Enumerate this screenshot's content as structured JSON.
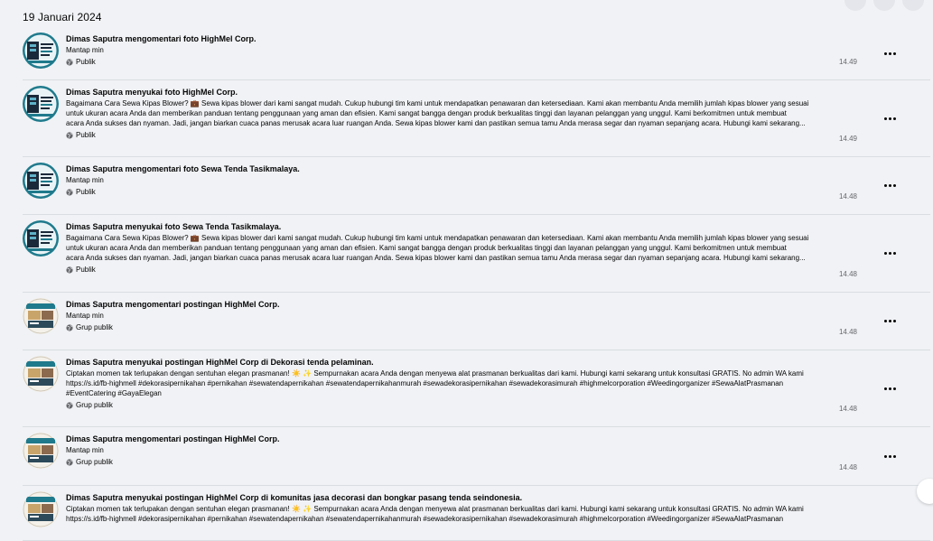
{
  "date_header": "19 Januari 2024",
  "colors": {
    "background": "#f0f2f5",
    "divider": "#dadde1",
    "time_gray": "#65676b",
    "logo_teal": "#1f7a8c"
  },
  "items": [
    {
      "avatar": "highmel-logo",
      "title": "Dimas Saputra mengomentari foto HighMel Corp.",
      "body": [
        "Mantap min"
      ],
      "privacy": "Publik",
      "privacy_icon": "globe-icon",
      "time": "14.49"
    },
    {
      "avatar": "highmel-logo",
      "title": "Dimas Saputra menyukai foto HighMel Corp.",
      "body": [
        "Bagaimana Cara Sewa Kipas Blower? 💼 Sewa kipas blower dari kami sangat mudah. Cukup hubungi tim kami untuk mendapatkan penawaran dan ketersediaan. Kami akan membantu Anda memilih jumlah kipas blower yang sesuai",
        "untuk ukuran acara Anda dan memberikan panduan tentang penggunaan yang aman dan efisien. Kami sangat bangga dengan produk berkualitas tinggi dan layanan pelanggan yang unggul. Kami berkomitmen untuk membuat",
        "acara Anda sukses dan nyaman. Jadi, jangan biarkan cuaca panas merusak acara luar ruangan Anda. Sewa kipas blower kami dan pastikan semua tamu Anda merasa segar dan nyaman sepanjang acara. Hubungi kami sekarang..."
      ],
      "privacy": "Publik",
      "privacy_icon": "globe-icon",
      "time": "14.49"
    },
    {
      "avatar": "highmel-logo",
      "title": "Dimas Saputra mengomentari foto Sewa Tenda Tasikmalaya.",
      "body": [
        "Mantap min"
      ],
      "privacy": "Publik",
      "privacy_icon": "globe-icon",
      "time": "14.48"
    },
    {
      "avatar": "highmel-logo",
      "title": "Dimas Saputra menyukai foto Sewa Tenda Tasikmalaya.",
      "body": [
        "Bagaimana Cara Sewa Kipas Blower? 💼 Sewa kipas blower dari kami sangat mudah. Cukup hubungi tim kami untuk mendapatkan penawaran dan ketersediaan. Kami akan membantu Anda memilih jumlah kipas blower yang sesuai",
        "untuk ukuran acara Anda dan memberikan panduan tentang penggunaan yang aman dan efisien. Kami sangat bangga dengan produk berkualitas tinggi dan layanan pelanggan yang unggul. Kami berkomitmen untuk membuat",
        "acara Anda sukses dan nyaman. Jadi, jangan biarkan cuaca panas merusak acara luar ruangan Anda. Sewa kipas blower kami dan pastikan semua tamu Anda merasa segar dan nyaman sepanjang acara. Hubungi kami sekarang..."
      ],
      "privacy": "Publik",
      "privacy_icon": "globe-icon",
      "time": "14.48"
    },
    {
      "avatar": "group-photo",
      "title": "Dimas Saputra mengomentari postingan HighMel Corp.",
      "body": [
        "Mantap min"
      ],
      "privacy": "Grup publik",
      "privacy_icon": "globe-icon",
      "time": "14.48"
    },
    {
      "avatar": "group-photo",
      "title": "Dimas Saputra menyukai postingan HighMel Corp di Dekorasi tenda pelaminan.",
      "body": [
        "Ciptakan momen tak terlupakan dengan sentuhan elegan prasmanan! ☀️ ✨ Sempurnakan acara Anda dengan menyewa alat prasmanan berkualitas dari kami. Hubungi kami sekarang untuk konsultasi GRATIS. No admin WA kami",
        "https://s.id/fb-highmell #dekorasipernikahan #pernikahan #sewatendapernikahan #sewatendapernikahanmurah #sewadekorasipernikahan #sewadekorasimurah #highmelcorporation #Weedingorganizer #SewaAlatPrasmanan",
        "#EventCatering #GayaElegan"
      ],
      "privacy": "Grup publik",
      "privacy_icon": "globe-icon",
      "time": "14.48"
    },
    {
      "avatar": "group-photo",
      "title": "Dimas Saputra mengomentari postingan HighMel Corp.",
      "body": [
        "Mantap min"
      ],
      "privacy": "Grup publik",
      "privacy_icon": "globe-icon",
      "time": "14.48"
    },
    {
      "avatar": "group-photo",
      "title": "Dimas Saputra menyukai postingan HighMel Corp di komunitas jasa decorasi dan bongkar pasang tenda seindonesia.",
      "body": [
        "Ciptakan momen tak terlupakan dengan sentuhan elegan prasmanan! ☀️ ✨ Sempurnakan acara Anda dengan menyewa alat prasmanan berkualitas dari kami. Hubungi kami sekarang untuk konsultasi GRATIS. No admin WA kami",
        "https://s.id/fb-highmell #dekorasipernikahan #pernikahan #sewatendapernikahan #sewatendapernikahanmurah #sewadekorasipernikahan #sewadekorasimurah #highmelcorporation #Weedingorganizer #SewaAlatPrasmanan"
      ],
      "privacy": "",
      "privacy_icon": "globe-icon",
      "time": ""
    }
  ]
}
